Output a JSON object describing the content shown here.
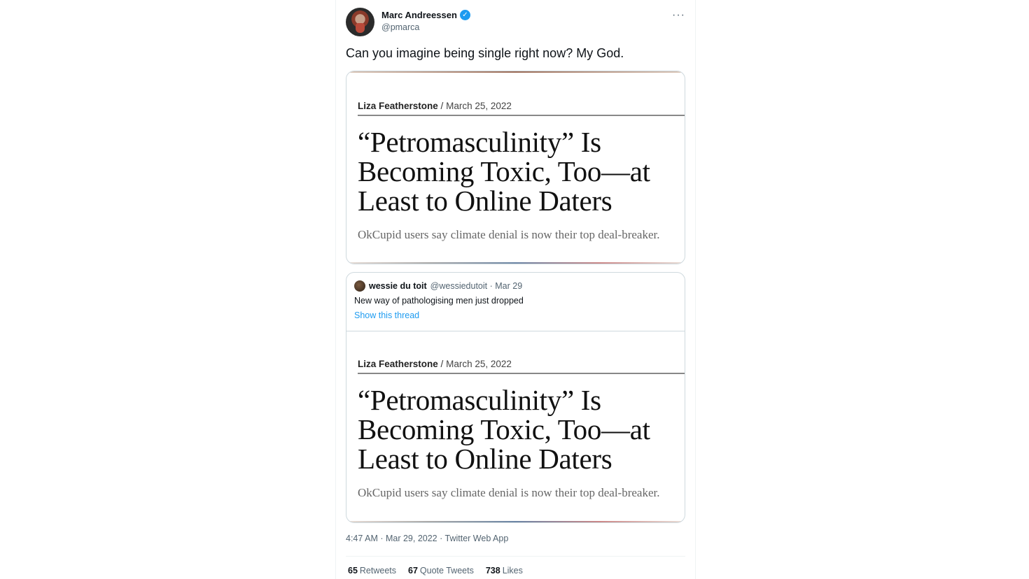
{
  "tweet": {
    "display_name": "Marc Andreessen",
    "verified_glyph": "✓",
    "handle": "@pmarca",
    "more_glyph": "···",
    "text": "Can you imagine being single right now? My God.",
    "timestamp": "4:47 AM · Mar 29, 2022 · Twitter Web App"
  },
  "article": {
    "author": "Liza Featherstone",
    "separator": "/",
    "date": "March 25, 2022",
    "headline_lines": [
      "“Petromasculinity” Is",
      "Becoming Toxic, Too—at",
      "Least to Online Daters"
    ],
    "dek": "OkCupid users say climate denial is now their top deal-breaker."
  },
  "quoted": {
    "name": "wessie du toit",
    "handle_date": "@wessiedutoit · Mar 29",
    "text": "New way of pathologising men just dropped",
    "show_thread": "Show this thread"
  },
  "stats": {
    "retweets_count": "65",
    "retweets_label": "Retweets",
    "quotes_count": "67",
    "quotes_label": "Quote Tweets",
    "likes_count": "738",
    "likes_label": "Likes"
  },
  "colors": {
    "accent": "#1d9bf0",
    "secondary_text": "#536471",
    "border": "#cfd9de"
  },
  "icons": [
    "verified-badge-icon",
    "more-options-icon"
  ]
}
